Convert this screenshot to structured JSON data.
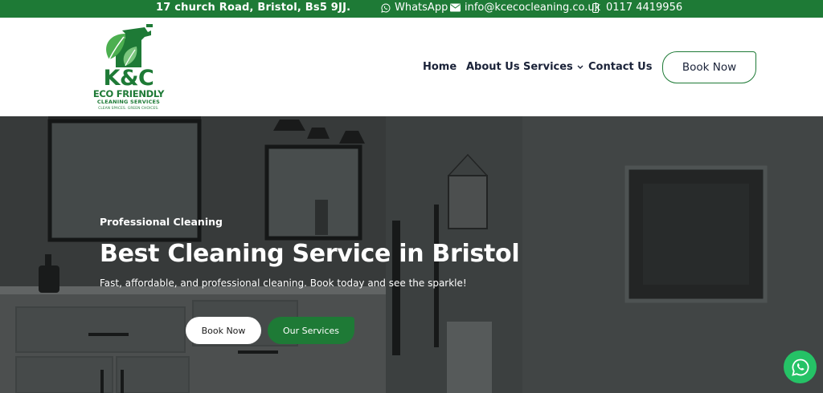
{
  "topbar": {
    "address": "17 church Road, Bristol, Bs5 9JJ.",
    "whatsapp_label": "WhatsApp",
    "email": "info@kcecocleaning.co.uk",
    "phone": "0117 4419956",
    "icons": [
      "whatsapp-icon",
      "envelope-icon",
      "phone-icon"
    ],
    "background_color": "#1e7a36"
  },
  "logo": {
    "brand": "K&C",
    "line1": "ECO FRIENDLY",
    "line2": "CLEANING SERVICES",
    "tagline": "CLEAN SPACES. GREEN CHOICES.",
    "color": "#1e7a36"
  },
  "nav": {
    "items": [
      {
        "label": "Home"
      },
      {
        "label": "About Us"
      },
      {
        "label": "Services",
        "has_dropdown": true
      },
      {
        "label": "Contact Us"
      }
    ],
    "cta": "Book Now"
  },
  "hero": {
    "eyebrow": "Professional Cleaning",
    "title": "Best Cleaning Service in Bristol",
    "subtitle": "Fast, affordable, and professional cleaning. Book today and see the sparkle!",
    "primary_button": "Book Now",
    "secondary_button": "Our Services"
  },
  "floating": {
    "icon": "whatsapp-icon",
    "color": "#25c266"
  }
}
